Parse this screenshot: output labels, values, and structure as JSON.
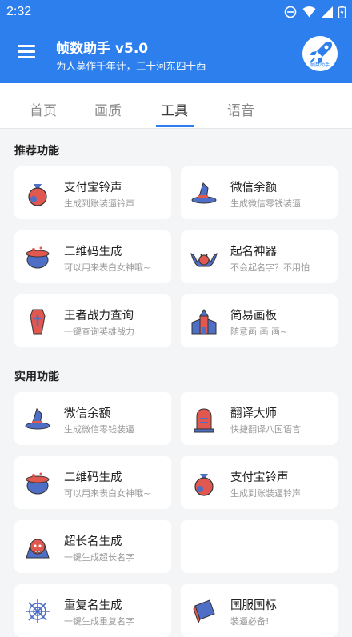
{
  "status_bar": {
    "time": "2:32"
  },
  "app": {
    "title": "帧数助手 v5.0",
    "subtitle": "为人莫作千年计，三十河东四十西",
    "logo_text": "帧数助手"
  },
  "tabs": [
    {
      "label": "首页"
    },
    {
      "label": "画质"
    },
    {
      "label": "工具"
    },
    {
      "label": "语音"
    }
  ],
  "active_tab": "工具",
  "sections": [
    {
      "title": "推荐功能",
      "items": [
        {
          "title": "支付宝铃声",
          "subtitle": "生成到账装逼铃声",
          "icon": "money-bag-icon"
        },
        {
          "title": "微信余额",
          "subtitle": "生成微信零钱装逼",
          "icon": "witch-hat-icon"
        },
        {
          "title": "二维码生成",
          "subtitle": "可以用来表白女神哦~",
          "icon": "cauldron-icon"
        },
        {
          "title": "起名神器",
          "subtitle": "不会起名字？不用怕",
          "icon": "bat-icon"
        },
        {
          "title": "王者战力查询",
          "subtitle": "一键查询英雄战力",
          "icon": "coffin-icon"
        },
        {
          "title": "简易画板",
          "subtitle": "随意画 画 画~",
          "icon": "church-icon"
        }
      ]
    },
    {
      "title": "实用功能",
      "items": [
        {
          "title": "微信余额",
          "subtitle": "生成微信零钱装逼",
          "icon": "witch-hat-icon"
        },
        {
          "title": "翻译大师",
          "subtitle": "快捷翻译八国语言",
          "icon": "tombstone-icon"
        },
        {
          "title": "二维码生成",
          "subtitle": "可以用来表白女神哦~",
          "icon": "cauldron-icon"
        },
        {
          "title": "支付宝铃声",
          "subtitle": "生成到账装逼铃声",
          "icon": "money-bag-icon"
        },
        {
          "title": "超长名生成",
          "subtitle": "一键生成超长名字",
          "icon": "vampire-icon"
        },
        {
          "title": "",
          "subtitle": "",
          "icon": ""
        },
        {
          "title": "重复名生成",
          "subtitle": "一键生成重复名字",
          "icon": "spider-web-icon"
        },
        {
          "title": "国服国标",
          "subtitle": "装逼必备!",
          "icon": "book-icon"
        }
      ]
    }
  ],
  "colors": {
    "primary": "#2c7fed",
    "icon_blue": "#4f6fc7",
    "icon_red": "#e0584f"
  }
}
